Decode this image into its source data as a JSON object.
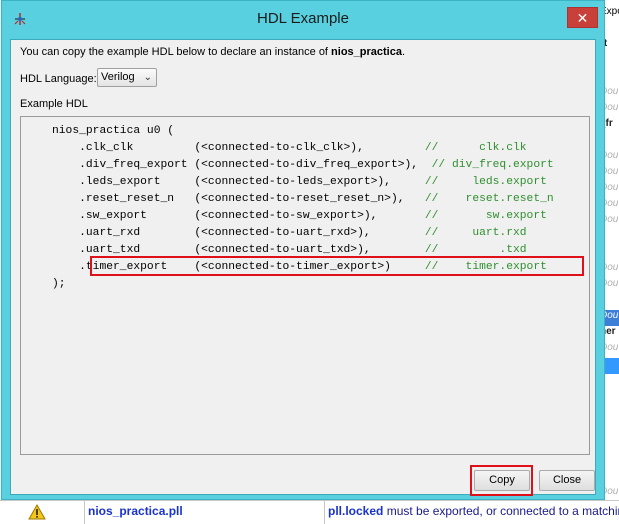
{
  "dialog": {
    "title": "HDL Example",
    "close_glyph": "✕",
    "intro_prefix": "You can copy the example HDL below to declare an instance of ",
    "intro_name": "nios_practica",
    "intro_suffix": ".",
    "language_label": "HDL Language:",
    "language_value": "Verilog",
    "example_label": "Example HDL",
    "code": {
      "header": "nios_practica u0 (",
      "lines": [
        {
          "port": ".clk_clk         ",
          "conn": "(<connected-to-clk_clk>),        ",
          "comment": "//      clk.clk"
        },
        {
          "port": ".div_freq_export ",
          "conn": "(<connected-to-div_freq_export>), ",
          "comment": "// div_freq.export"
        },
        {
          "port": ".leds_export     ",
          "conn": "(<connected-to-leds_export>),    ",
          "comment": "//     leds.export"
        },
        {
          "port": ".reset_reset_n   ",
          "conn": "(<connected-to-reset_reset_n>),  ",
          "comment": "//    reset.reset_n"
        },
        {
          "port": ".sw_export       ",
          "conn": "(<connected-to-sw_export>),      ",
          "comment": "//       sw.export"
        },
        {
          "port": ".uart_rxd        ",
          "conn": "(<connected-to-uart_rxd>),       ",
          "comment": "//     uart.rxd"
        },
        {
          "port": ".uart_txd        ",
          "conn": "(<connected-to-uart_txd>),       ",
          "comment": "//         .txd"
        },
        {
          "port": ".timer_export    ",
          "conn": "(<connected-to-timer_export>)    ",
          "comment": "//    timer.export"
        }
      ],
      "footer": ");"
    },
    "copy_label": "Copy",
    "close_label": "Close"
  },
  "background": {
    "right_rows": [
      "Expor",
      "",
      "rt",
      "",
      "",
      "Dou",
      "Dou",
      "_fr",
      "",
      "Dou",
      "Dou",
      "Dou",
      "Dou",
      "Dou",
      "",
      "",
      "Dou",
      "Dou",
      "",
      "Dou",
      "her",
      "Dou",
      "",
      "",
      "",
      "",
      "",
      "",
      "",
      "",
      "Dou"
    ],
    "bottom_name": "nios_practica.pll",
    "bottom_msg_bold": "pll.locked",
    "bottom_msg_rest": " must be exported, or connected to a matching co"
  },
  "colors": {
    "titlebar": "#58d0e0",
    "close_button": "#c9403a",
    "highlight": "#e0101a",
    "comment": "#2f8f2f"
  }
}
